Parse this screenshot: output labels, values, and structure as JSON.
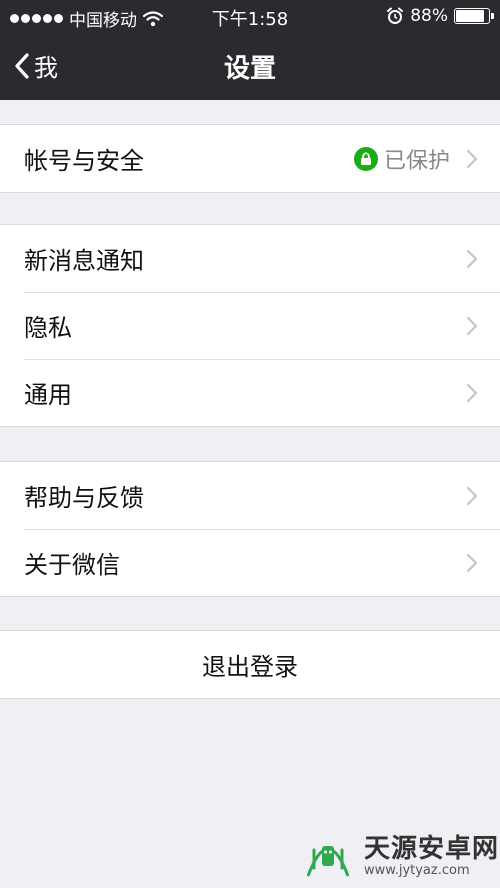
{
  "status_bar": {
    "carrier": "中国移动",
    "time": "下午1:58",
    "battery": "88%",
    "battery_level": 0.88
  },
  "nav": {
    "back_label": "我",
    "title": "设置"
  },
  "groups": [
    {
      "rows": [
        {
          "label": "帐号与安全",
          "status": "已保护"
        }
      ]
    },
    {
      "rows": [
        {
          "label": "新消息通知"
        },
        {
          "label": "隐私"
        },
        {
          "label": "通用"
        }
      ]
    },
    {
      "rows": [
        {
          "label": "帮助与反馈"
        },
        {
          "label": "关于微信"
        }
      ]
    }
  ],
  "logout_label": "退出登录",
  "watermark": {
    "title": "天源安卓网",
    "url": "www.jytyaz.com"
  },
  "colors": {
    "nav_bg": "#2b2b2f",
    "page_bg": "#efeff4",
    "protected_green": "#1aad19"
  }
}
